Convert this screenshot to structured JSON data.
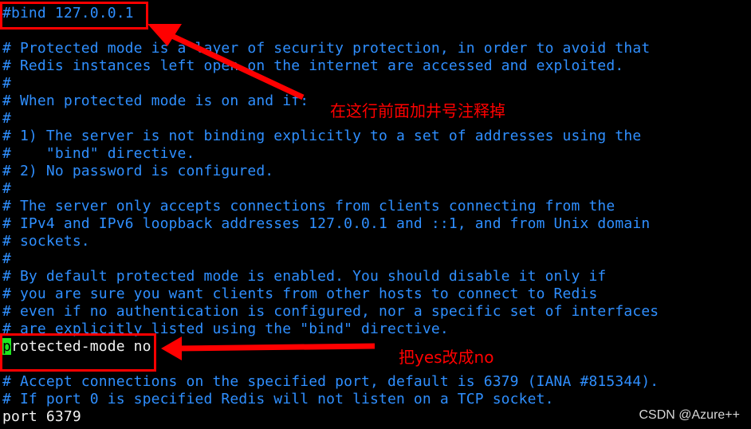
{
  "terminal": {
    "lines": [
      {
        "text": "#bind 127.0.0.1",
        "type": "comment"
      },
      {
        "text": "",
        "type": "comment"
      },
      {
        "text": "# Protected mode is a layer of security protection, in order to avoid that",
        "type": "comment"
      },
      {
        "text": "# Redis instances left open on the internet are accessed and exploited.",
        "type": "comment"
      },
      {
        "text": "#",
        "type": "comment"
      },
      {
        "text": "# When protected mode is on and if:",
        "type": "comment"
      },
      {
        "text": "#",
        "type": "comment"
      },
      {
        "text": "# 1) The server is not binding explicitly to a set of addresses using the",
        "type": "comment"
      },
      {
        "text": "#    \"bind\" directive.",
        "type": "comment"
      },
      {
        "text": "# 2) No password is configured.",
        "type": "comment"
      },
      {
        "text": "#",
        "type": "comment"
      },
      {
        "text": "# The server only accepts connections from clients connecting from the",
        "type": "comment"
      },
      {
        "text": "# IPv4 and IPv6 loopback addresses 127.0.0.1 and ::1, and from Unix domain",
        "type": "comment"
      },
      {
        "text": "# sockets.",
        "type": "comment"
      },
      {
        "text": "#",
        "type": "comment"
      },
      {
        "text": "# By default protected mode is enabled. You should disable it only if",
        "type": "comment"
      },
      {
        "text": "# you are sure you want clients from other hosts to connect to Redis",
        "type": "comment"
      },
      {
        "text": "# even if no authentication is configured, nor a specific set of interfaces",
        "type": "comment"
      },
      {
        "text": "# are explicitly listed using the \"bind\" directive.",
        "type": "comment"
      },
      {
        "text": "rotected-mode no",
        "type": "code",
        "cursor_char": "p"
      },
      {
        "text": "",
        "type": "code"
      },
      {
        "text": "# Accept connections on the specified port, default is 6379 (IANA #815344).",
        "type": "comment"
      },
      {
        "text": "# If port 0 is specified Redis will not listen on a TCP socket.",
        "type": "comment"
      },
      {
        "text": "port 6379",
        "type": "code"
      }
    ]
  },
  "annotations": {
    "note_bind": "在这行前面加井号注释掉",
    "note_protected": "把yes改成no",
    "color": "#ff0000"
  },
  "watermark": "CSDN @Azure++",
  "colors": {
    "comment": "#2f8fff",
    "code": "#f2f2f2",
    "cursor": "#1ee81e"
  }
}
